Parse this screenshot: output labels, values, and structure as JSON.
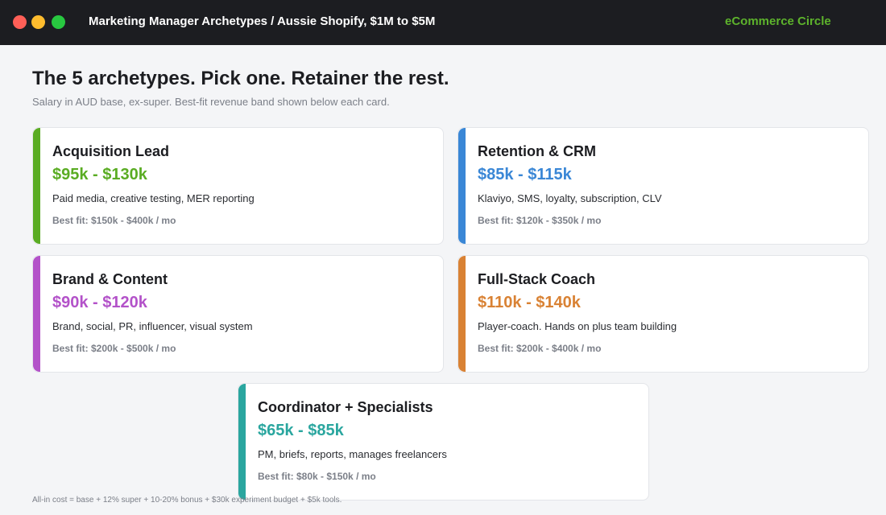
{
  "window": {
    "title": "Marketing Manager Archetypes  /  Aussie Shopify, $1M to $5M",
    "brand": "eCommerce Circle",
    "controls": [
      "close",
      "minimize",
      "maximize"
    ]
  },
  "header": {
    "headline": "The 5 archetypes. Pick one. Retainer the rest.",
    "subhead": "Salary in AUD base, ex-super. Best-fit revenue band shown below each card."
  },
  "cards": [
    {
      "name": "Acquisition Lead",
      "salary": "$95k - $130k",
      "desc": "Paid media, creative testing, MER reporting",
      "fit": "Best fit: $150k - $400k / mo",
      "color": "#5aac23"
    },
    {
      "name": "Retention & CRM",
      "salary": "$85k - $115k",
      "desc": "Klaviyo, SMS, loyalty, subscription, CLV",
      "fit": "Best fit: $120k - $350k / mo",
      "color": "#3a87d6"
    },
    {
      "name": "Brand & Content",
      "salary": "$90k - $120k",
      "desc": "Brand, social, PR, influencer, visual system",
      "fit": "Best fit: $200k - $500k / mo",
      "color": "#b352c9"
    },
    {
      "name": "Full-Stack Coach",
      "salary": "$110k - $140k",
      "desc": "Player-coach. Hands on plus team building",
      "fit": "Best fit: $200k - $400k / mo",
      "color": "#d98234"
    },
    {
      "name": "Coordinator + Specialists",
      "salary": "$65k - $85k",
      "desc": "PM, briefs, reports, manages freelancers",
      "fit": "Best fit: $80k - $150k / mo",
      "color": "#2aa69f"
    }
  ],
  "footnote": "All-in cost = base + 12% super + 10-20% bonus + $30k experiment budget + $5k tools."
}
